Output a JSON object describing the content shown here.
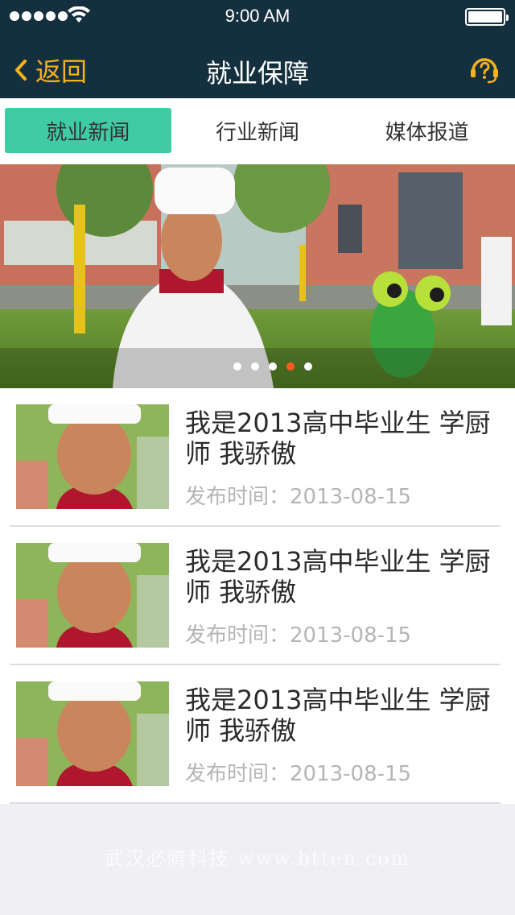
{
  "status": {
    "time": "9:00 AM"
  },
  "nav": {
    "back_label": "返回",
    "title": "就业保障"
  },
  "tabs": [
    {
      "label": "就业新闻",
      "active": true
    },
    {
      "label": "行业新闻",
      "active": false
    },
    {
      "label": "媒体报道",
      "active": false
    }
  ],
  "banner": {
    "dots": 5,
    "active_dot": 3
  },
  "news": [
    {
      "title": "我是2013高中毕业生 学厨师 我骄傲",
      "date": "发布时间：2013-08-15"
    },
    {
      "title": "我是2013高中毕业生 学厨师 我骄傲",
      "date": "发布时间：2013-08-15"
    },
    {
      "title": "我是2013高中毕业生 学厨师 我骄傲",
      "date": "发布时间：2013-08-15"
    }
  ],
  "watermark": "武汉必腾科技 www.btten.com",
  "colors": {
    "header": "#14303f",
    "accent": "#f6b21a",
    "tab_active": "#3fcca4",
    "dot_active": "#ff5a1f"
  }
}
